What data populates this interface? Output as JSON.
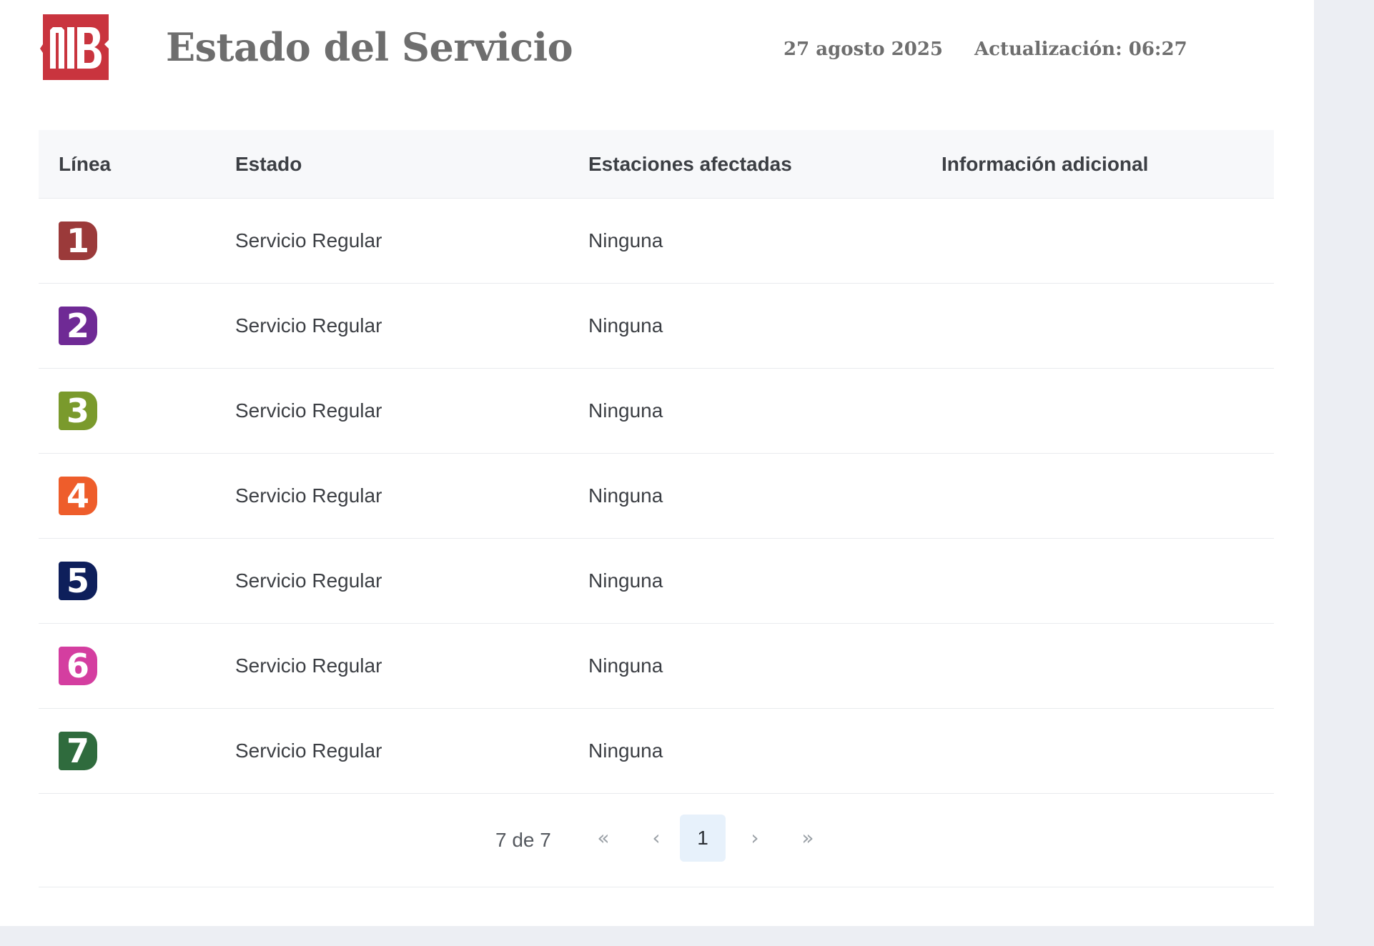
{
  "header": {
    "logo_label": "MB",
    "title": "Estado del Servicio",
    "date": "27 agosto 2025",
    "update": "Actualización: 06:27"
  },
  "table": {
    "columns": [
      "Línea",
      "Estado",
      "Estaciones afectadas",
      "Información adicional"
    ],
    "rows": [
      {
        "line": "1",
        "color": "#9b3a3a",
        "status": "Servicio Regular",
        "stations": "Ninguna",
        "info": ""
      },
      {
        "line": "2",
        "color": "#6f2a95",
        "status": "Servicio Regular",
        "stations": "Ninguna",
        "info": ""
      },
      {
        "line": "3",
        "color": "#7a9a2c",
        "status": "Servicio Regular",
        "stations": "Ninguna",
        "info": ""
      },
      {
        "line": "4",
        "color": "#ee5d2b",
        "status": "Servicio Regular",
        "stations": "Ninguna",
        "info": ""
      },
      {
        "line": "5",
        "color": "#0e1f5b",
        "status": "Servicio Regular",
        "stations": "Ninguna",
        "info": ""
      },
      {
        "line": "6",
        "color": "#d43ea0",
        "status": "Servicio Regular",
        "stations": "Ninguna",
        "info": ""
      },
      {
        "line": "7",
        "color": "#2f6b3d",
        "status": "Servicio Regular",
        "stations": "Ninguna",
        "info": ""
      }
    ]
  },
  "pagination": {
    "count_text": "7 de 7",
    "first_icon": "double-chevron-left-icon",
    "prev_icon": "chevron-left-icon",
    "current_page": "1",
    "next_icon": "chevron-right-icon",
    "last_icon": "double-chevron-right-icon"
  },
  "colors": {
    "brand": "#c9343e",
    "title_text": "#6e6e6e",
    "header_bg": "#f7f8fa",
    "current_page_bg": "#e7f1fb"
  }
}
